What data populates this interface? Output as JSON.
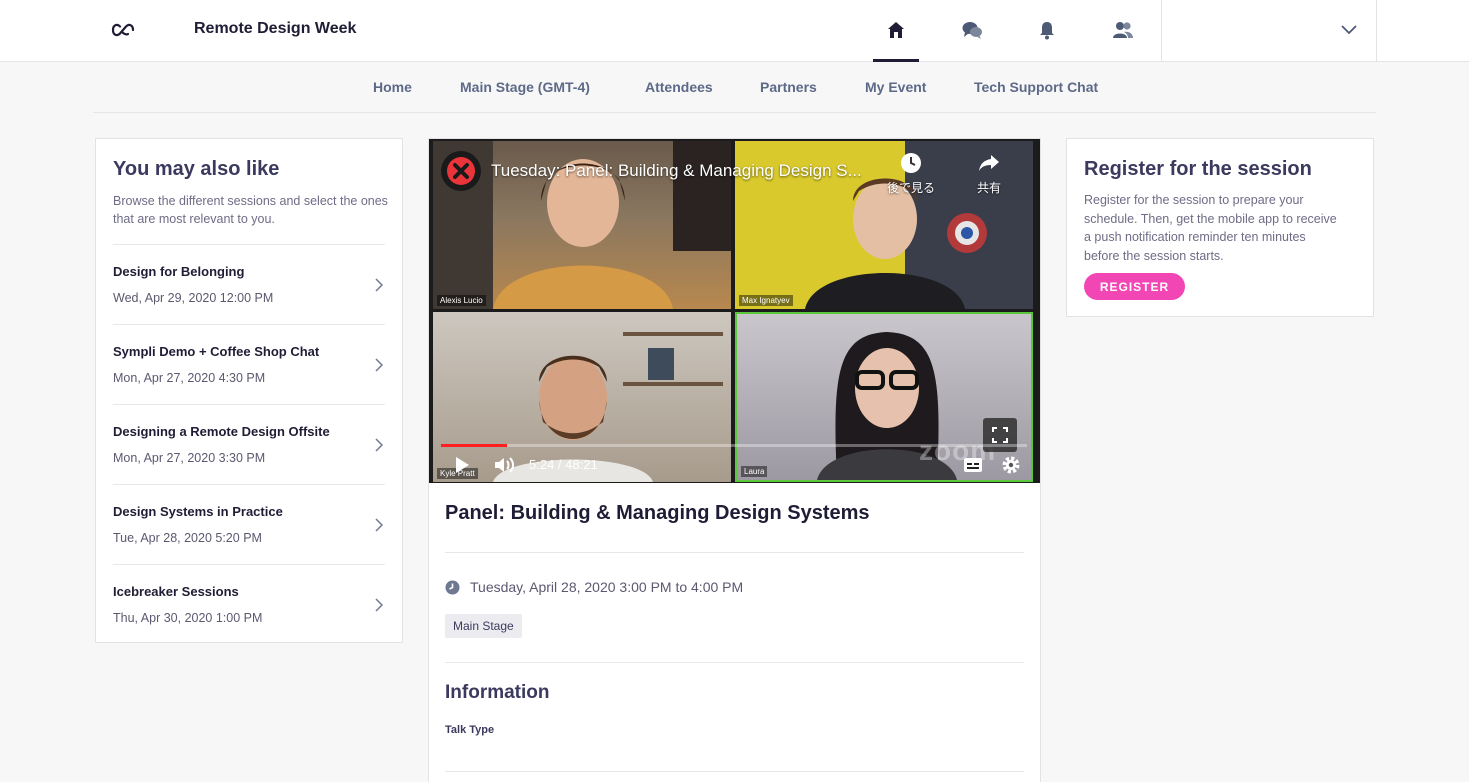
{
  "header": {
    "event_title": "Remote Design Week",
    "icons": [
      "home-icon",
      "chat-icon",
      "bell-icon",
      "people-icon",
      "chevron-down-icon"
    ]
  },
  "nav": {
    "links": [
      "Home",
      "Main Stage (GMT-4)",
      "Attendees",
      "Partners",
      "My Event",
      "Tech Support Chat"
    ]
  },
  "recommendations": {
    "title": "You may also like",
    "description": "Browse the different sessions and select the ones that are most relevant to you.",
    "items": [
      {
        "title": "Design for Belonging",
        "date": "Wed, Apr 29, 2020 12:00 PM"
      },
      {
        "title": "Sympli Demo + Coffee Shop Chat",
        "date": "Mon, Apr 27, 2020 4:30 PM"
      },
      {
        "title": "Designing a Remote Design Offsite",
        "date": "Mon, Apr 27, 2020 3:30 PM"
      },
      {
        "title": "Design Systems in Practice",
        "date": "Tue, Apr 28, 2020 5:20 PM"
      },
      {
        "title": "Icebreaker Sessions",
        "date": "Thu, Apr 30, 2020 1:00 PM"
      }
    ]
  },
  "video": {
    "title": "Tuesday: Panel: Building & Managing Design S...",
    "watch_later": "後で見る",
    "share": "共有",
    "time": "5:24 / 48:21",
    "progress": 0.112,
    "participants": [
      "Alexis Lucio",
      "Max Ignatyev",
      "Kyle Pratt",
      "Laura"
    ],
    "watermark": "zoom"
  },
  "session": {
    "title": "Panel: Building & Managing Design Systems",
    "datetime": "Tuesday, April 28, 2020 3:00 PM to 4:00 PM",
    "tag": "Main Stage",
    "info_heading": "Information",
    "talk_type_label": "Talk Type"
  },
  "register": {
    "title": "Register for the session",
    "description": "Register for the session to prepare your schedule. Then, get the mobile app to receive a push notification reminder ten minutes before the session starts.",
    "button": "REGISTER"
  },
  "colors": {
    "accent": "#f246b5",
    "text_dark": "#1f1d35",
    "nav_text": "#5d6a87",
    "progress": "#ff1f1f"
  }
}
